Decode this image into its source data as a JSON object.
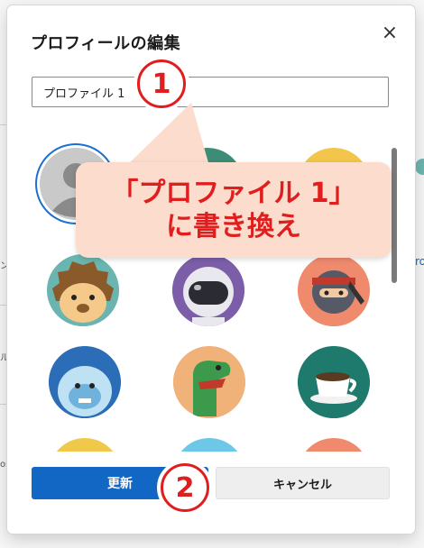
{
  "dialog": {
    "title": "プロフィールの編集",
    "close_glyph": "×",
    "name_value": "プロファイル 1",
    "update_label": "更新",
    "cancel_label": "キャンセル"
  },
  "avatars": [
    {
      "name": "generic-person",
      "selected": true
    },
    {
      "name": "hidden-behind-callout-1"
    },
    {
      "name": "hidden-behind-callout-2"
    },
    {
      "name": "hedgehog"
    },
    {
      "name": "astronaut"
    },
    {
      "name": "ninja"
    },
    {
      "name": "yeti"
    },
    {
      "name": "dinosaur"
    },
    {
      "name": "coffee-cup"
    },
    {
      "name": "partial-yellow"
    },
    {
      "name": "partial-blue"
    },
    {
      "name": "partial-orange"
    }
  ],
  "annotation": {
    "callout_line1": "「プロファイル 1」",
    "callout_line2": "に書き換え",
    "step1": "1",
    "step2": "2",
    "accent_color": "#e11e1e",
    "callout_bg": "#fbdccd"
  },
  "background": {
    "right_link_fragment": "ro",
    "left_fragment_1": "ン",
    "left_fragment_2": "ル",
    "left_fragment_3": "os"
  }
}
